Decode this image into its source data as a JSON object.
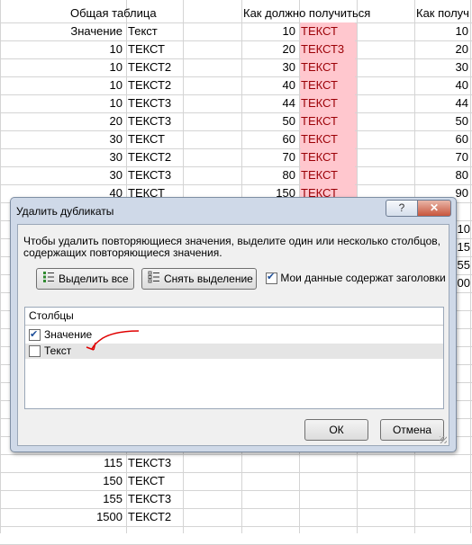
{
  "sheet": {
    "headers": {
      "a": "Общая таблица",
      "b": "Как должно получиться",
      "c": "Как получ"
    },
    "rows_top": [
      {
        "a_num": "Значение",
        "a_txt": "Текст",
        "b_num": "10",
        "b_txt": "ТЕКСТ",
        "c_num": "10"
      },
      {
        "a_num": "10",
        "a_txt": "ТЕКСТ",
        "b_num": "20",
        "b_txt": "ТЕКСТ3",
        "c_num": "20"
      },
      {
        "a_num": "10",
        "a_txt": "ТЕКСТ2",
        "b_num": "30",
        "b_txt": "ТЕКСТ",
        "c_num": "30"
      },
      {
        "a_num": "10",
        "a_txt": "ТЕКСТ2",
        "b_num": "40",
        "b_txt": "ТЕКСТ",
        "c_num": "40"
      },
      {
        "a_num": "10",
        "a_txt": "ТЕКСТ3",
        "b_num": "44",
        "b_txt": "ТЕКСТ",
        "c_num": "44"
      },
      {
        "a_num": "20",
        "a_txt": "ТЕКСТ3",
        "b_num": "50",
        "b_txt": "ТЕКСТ",
        "c_num": "50"
      },
      {
        "a_num": "30",
        "a_txt": "ТЕКСТ",
        "b_num": "60",
        "b_txt": "ТЕКСТ",
        "c_num": "60"
      },
      {
        "a_num": "30",
        "a_txt": "ТЕКСТ2",
        "b_num": "70",
        "b_txt": "ТЕКСТ",
        "c_num": "70"
      },
      {
        "a_num": "30",
        "a_txt": "ТЕКСТ3",
        "b_num": "80",
        "b_txt": "ТЕКСТ",
        "c_num": "80"
      },
      {
        "a_num": "40",
        "a_txt": "ТЕКСТ",
        "b_num": "150",
        "b_txt": "ТЕКСТ",
        "c_num": "90"
      }
    ],
    "rows_bottom": [
      {
        "a_num": "115",
        "a_txt": "ТЕКСТ3"
      },
      {
        "a_num": "150",
        "a_txt": "ТЕКСТ"
      },
      {
        "a_num": "155",
        "a_txt": "ТЕКСТ3"
      },
      {
        "a_num": "1500",
        "a_txt": "ТЕКСТ2"
      }
    ],
    "partial_right": [
      "10",
      "15",
      "55",
      "00"
    ]
  },
  "dialog": {
    "title": "Удалить дубликаты",
    "help_label": "?",
    "close_label": "✕",
    "description": "Чтобы удалить повторяющиеся значения, выделите один или несколько столбцов, содержащих повторяющиеся значения.",
    "select_all_label": "Выделить все",
    "deselect_label": "Снять выделение",
    "headers_checkbox_label": "Мои данные содержат заголовки",
    "headers_checked": true,
    "columns_header": "Столбцы",
    "columns": [
      {
        "label": "Значение",
        "checked": true
      },
      {
        "label": "Текст",
        "checked": false
      }
    ],
    "ok_label": "ОК",
    "cancel_label": "Отмена"
  },
  "colors": {
    "highlight_bg": "#ffc7ce",
    "highlight_text": "#9c0006",
    "arrow": "#e00000"
  }
}
